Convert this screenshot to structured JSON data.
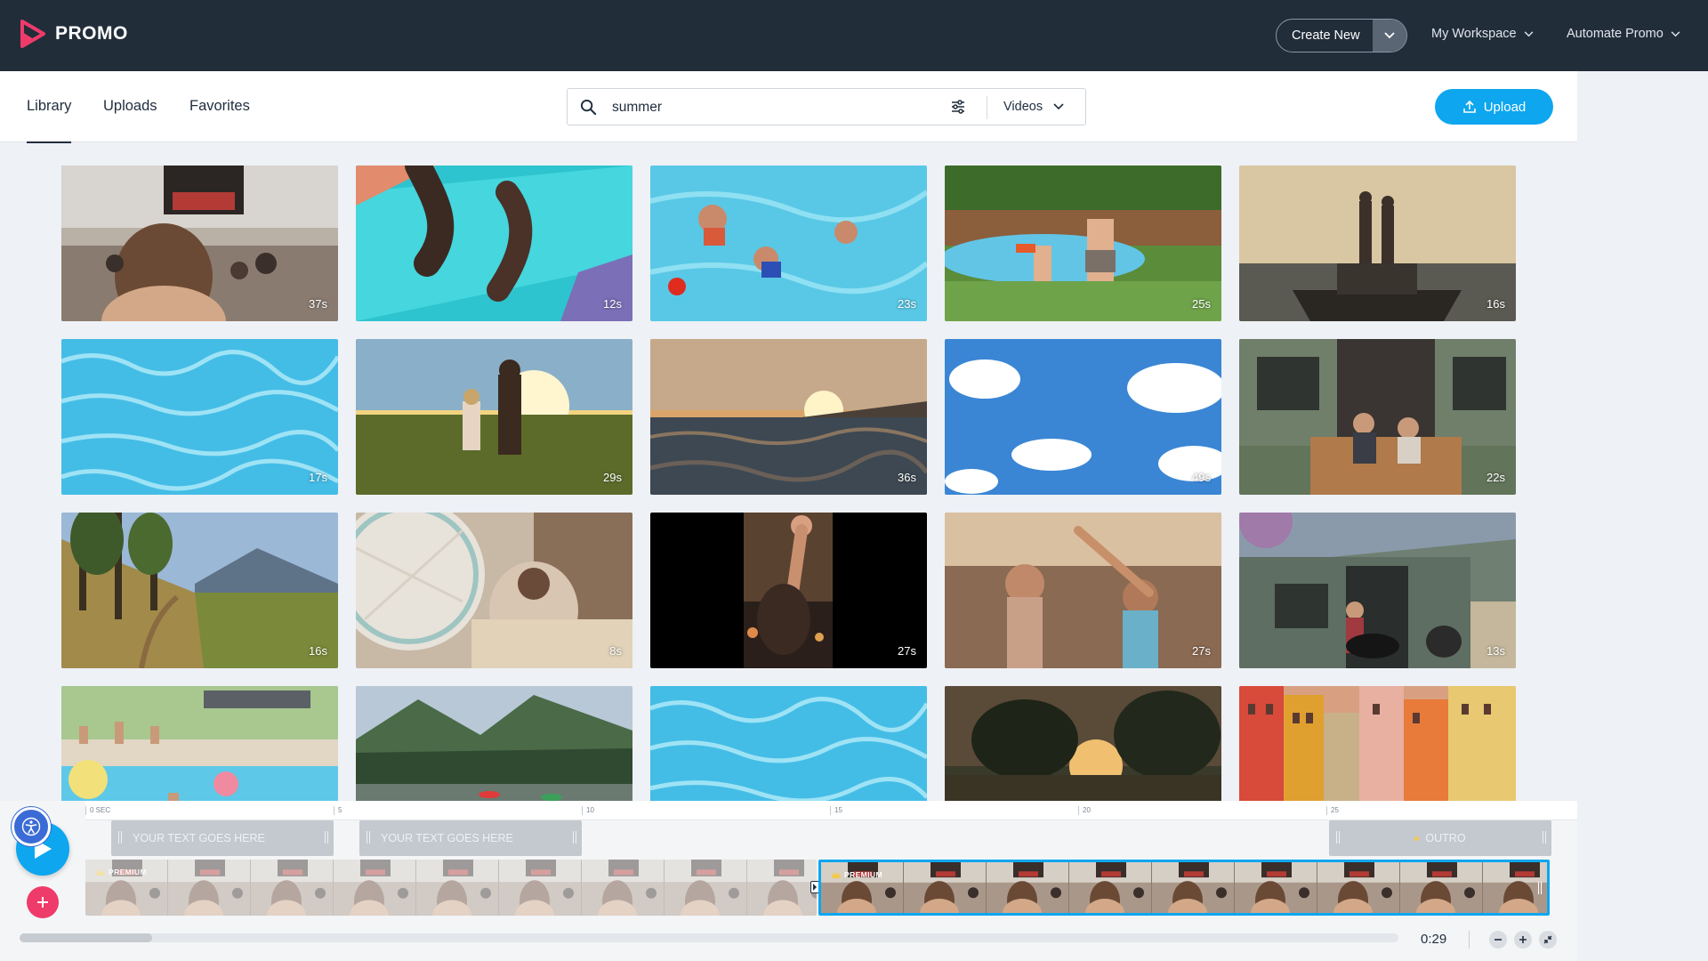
{
  "brand": {
    "name": "PROMO",
    "accent": "#0da6ef",
    "logo_color": "#ef3b6a"
  },
  "topbar": {
    "create_label": "Create New",
    "workspace_label": "My Workspace",
    "automate_label": "Automate Promo"
  },
  "tabs": [
    {
      "label": "Library",
      "active": true
    },
    {
      "label": "Uploads",
      "active": false
    },
    {
      "label": "Favorites",
      "active": false
    }
  ],
  "search": {
    "value": "summer",
    "type_label": "Videos"
  },
  "upload_label": "Upload",
  "thumbnails": [
    {
      "duration": "37s",
      "scene": "festival-crowd"
    },
    {
      "duration": "12s",
      "scene": "paddle-board"
    },
    {
      "duration": "23s",
      "scene": "kids-pool"
    },
    {
      "duration": "25s",
      "scene": "backyard-pool"
    },
    {
      "duration": "16s",
      "scene": "boat-sunset"
    },
    {
      "duration": "17s",
      "scene": "water-surface"
    },
    {
      "duration": "29s",
      "scene": "meadow-sun"
    },
    {
      "duration": "36s",
      "scene": "sea-sunset"
    },
    {
      "duration": "49s",
      "scene": "sky-clouds"
    },
    {
      "duration": "22s",
      "scene": "porch-couple"
    },
    {
      "duration": "16s",
      "scene": "hill-trail"
    },
    {
      "duration": "8s",
      "scene": "fan-room"
    },
    {
      "duration": "27s",
      "scene": "concert-vertical"
    },
    {
      "duration": "27s",
      "scene": "festival-dance"
    },
    {
      "duration": "13s",
      "scene": "house-dog"
    },
    {
      "duration": "",
      "scene": "pool-party"
    },
    {
      "duration": "",
      "scene": "mountain-lake"
    },
    {
      "duration": "",
      "scene": "water-surface"
    },
    {
      "duration": "",
      "scene": "forest-sunset"
    },
    {
      "duration": "",
      "scene": "colorful-town"
    }
  ],
  "timeline": {
    "ticks": [
      "0 SEC",
      "5",
      "10",
      "15",
      "20",
      "25"
    ],
    "text_clips": [
      "YOUR TEXT GOES HERE",
      "YOUR TEXT GOES HERE"
    ],
    "outro_label": "OUTRO",
    "premium_label": "PREMIUM",
    "time": "0:29",
    "scroll_fraction": 0.096
  }
}
